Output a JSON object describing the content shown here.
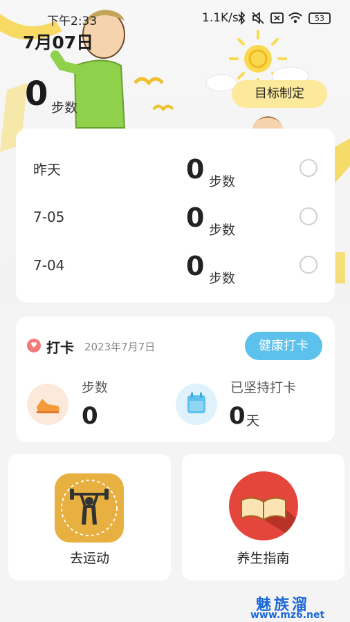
{
  "status_bar": {
    "time": "下午2:33",
    "network_speed": "1.1K/s",
    "battery": "53"
  },
  "header": {
    "date": "7月07日",
    "steps_today": "0",
    "steps_unit": "步数",
    "goal_button": "目标制定"
  },
  "history": [
    {
      "label": "昨天",
      "value": "0",
      "unit": "步数"
    },
    {
      "label": "7-05",
      "value": "0",
      "unit": "步数"
    },
    {
      "label": "7-04",
      "value": "0",
      "unit": "步数"
    }
  ],
  "checkin": {
    "title": "打卡",
    "date": "2023年7月7日",
    "button": "健康打卡",
    "steps_label": "步数",
    "steps_value": "0",
    "streak_label": "已坚持打卡",
    "streak_value": "0",
    "streak_unit": "天"
  },
  "tiles": [
    {
      "label": "去运动",
      "icon": "weightlifter-icon"
    },
    {
      "label": "养生指南",
      "icon": "open-book-icon"
    }
  ],
  "watermark": {
    "line1": "魅族溜",
    "line2": "www.mz6.net"
  },
  "colors": {
    "goal_button_bg": "#fde99c",
    "checkin_button_bg": "#5cc1ec",
    "heart": "#f27a7a",
    "exercise_tile": "#e8b040",
    "guide_tile": "#e4463c"
  }
}
